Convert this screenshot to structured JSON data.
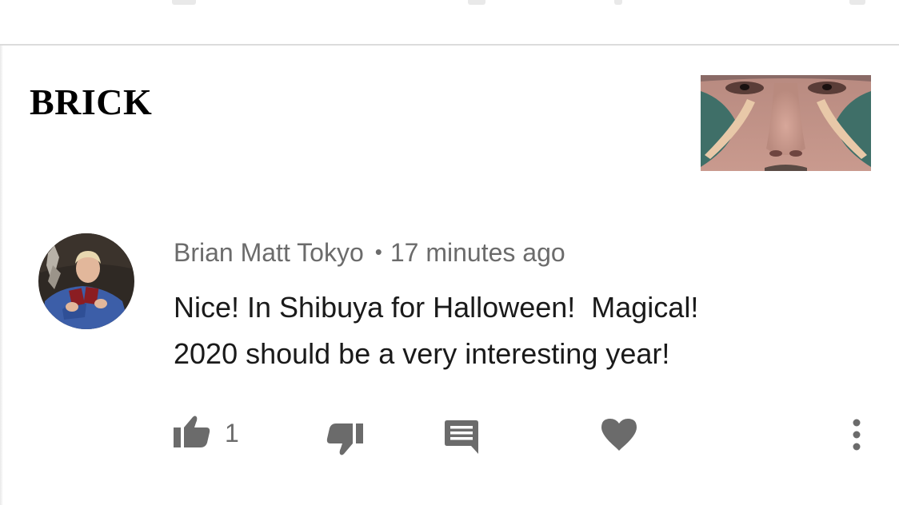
{
  "meme": {
    "title": "BRICK"
  },
  "comment": {
    "author": "Brian Matt Tokyo",
    "separator": "•",
    "timestamp": "17 minutes ago",
    "text_lines": [
      "Nice! In Shibuya for Halloween!  Magical!",
      "2020 should be a very interesting year!"
    ],
    "like_count": "1"
  },
  "icons": {
    "like": "thumbs-up-icon",
    "dislike": "thumbs-down-icon",
    "reply": "comment-icon",
    "heart": "heart-icon",
    "more": "more-vertical-icon"
  },
  "colors": {
    "icon": "#6b6b6b",
    "text": "#1a1a1a",
    "meta": "#6b6b6b",
    "divider": "#dcdcdc"
  }
}
